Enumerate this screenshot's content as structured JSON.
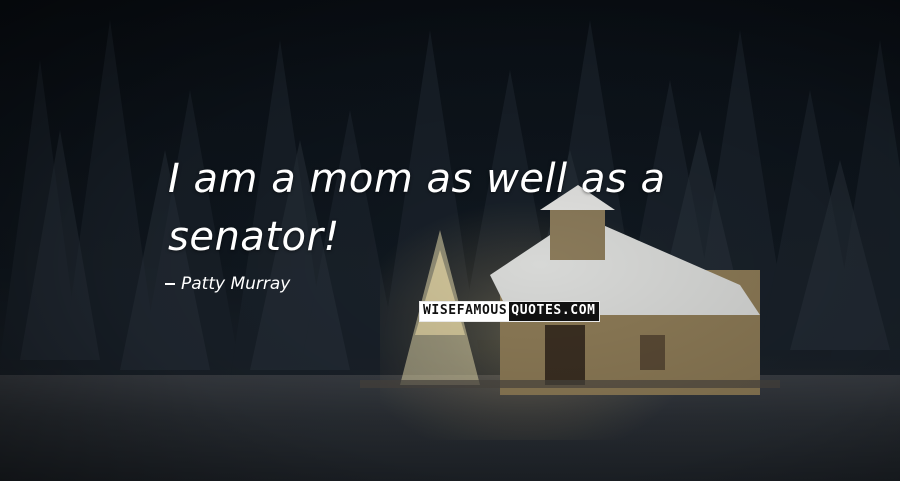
{
  "quote": {
    "line_1": "I am a mom as well as a",
    "line_2": "senator!"
  },
  "author": {
    "name": "Patty Murray"
  },
  "watermark": {
    "part_1": "WISEFAMOUS",
    "part_2": "QUOTES.COM"
  },
  "colors": {
    "text": "#ffffff",
    "background_dark": "#0c1219",
    "chapel_glow": "#ffe196"
  },
  "icons": {
    "author_prefix": "dash-icon"
  }
}
